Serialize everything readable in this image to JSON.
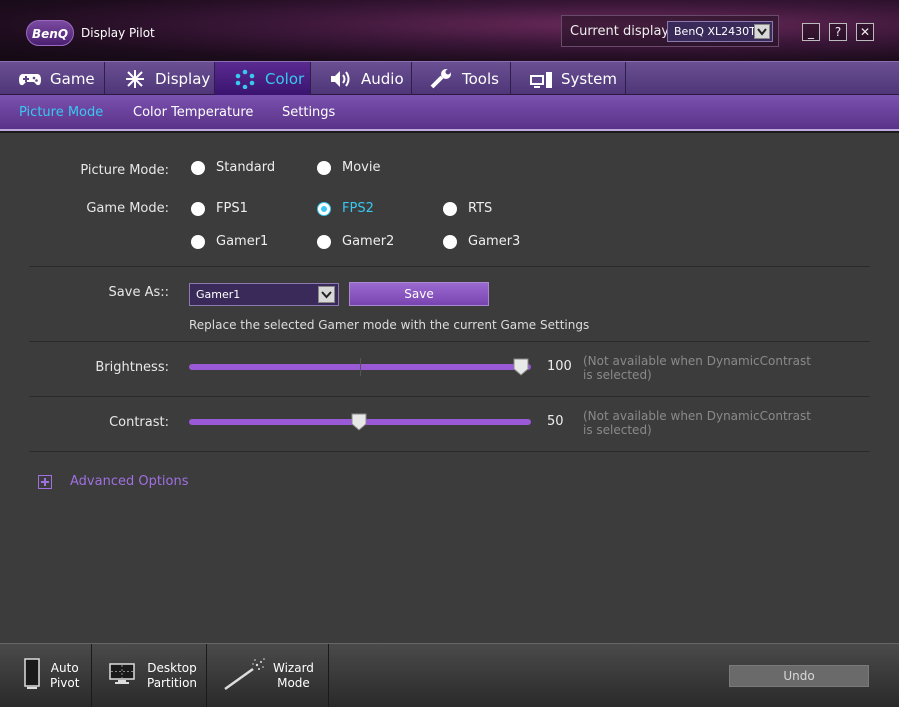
{
  "app": {
    "brand": "BenQ",
    "title": "Display Pilot"
  },
  "display": {
    "label": "Current display",
    "value": "BenQ XL2430T"
  },
  "window_buttons": {
    "minimize": "_",
    "help": "?",
    "close": "✕"
  },
  "tabs": [
    {
      "label": "Game",
      "icon": "gamepad-icon"
    },
    {
      "label": "Display",
      "icon": "display-icon"
    },
    {
      "label": "Color",
      "icon": "color-dots-icon",
      "active": true
    },
    {
      "label": "Audio",
      "icon": "speaker-icon"
    },
    {
      "label": "Tools",
      "icon": "wrench-icon"
    },
    {
      "label": "System",
      "icon": "system-icon"
    }
  ],
  "subtabs": [
    {
      "label": "Picture Mode",
      "active": true
    },
    {
      "label": "Color Temperature"
    },
    {
      "label": "Settings"
    }
  ],
  "picture_mode": {
    "label": "Picture Mode:",
    "options": [
      "Standard",
      "Movie"
    ]
  },
  "game_mode": {
    "label": "Game Mode:",
    "options": [
      "FPS1",
      "FPS2",
      "RTS",
      "Gamer1",
      "Gamer2",
      "Gamer3"
    ],
    "selected": "FPS2"
  },
  "save_as": {
    "label": "Save As::",
    "value": "Gamer1",
    "button": "Save",
    "note": "Replace the selected Gamer mode with the current Game Settings"
  },
  "brightness": {
    "label": "Brightness:",
    "value": "100",
    "level": 100,
    "hint": "(Not available when DynamicContrast is selected)"
  },
  "contrast": {
    "label": "Contrast:",
    "value": "50",
    "level": 50,
    "hint": "(Not available when DynamicContrast is selected)"
  },
  "advanced": {
    "label": "Advanced Options"
  },
  "bottom": {
    "auto_pivot": {
      "line1": "Auto",
      "line2": "Pivot"
    },
    "desktop_partition": {
      "line1": "Desktop",
      "line2": "Partition"
    },
    "wizard_mode": {
      "line1": "Wizard",
      "line2": "Mode"
    },
    "undo": "Undo"
  },
  "colors": {
    "accent": "#38c8f0",
    "purple": "#9a5ad8",
    "tab_bar": "#5e4488"
  }
}
